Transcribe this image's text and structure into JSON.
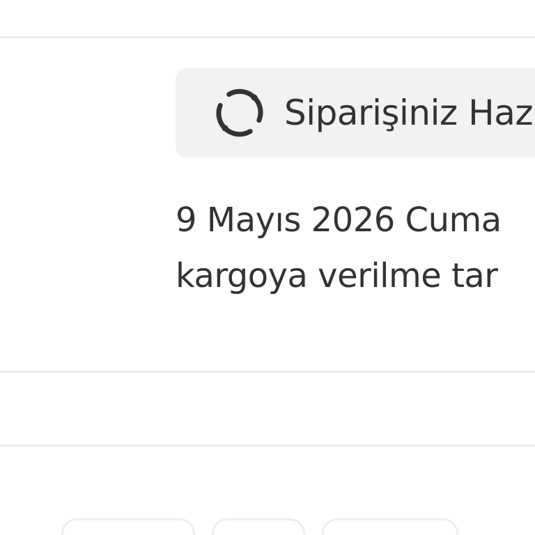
{
  "order_status": {
    "label": "Siparişiniz Haz",
    "icon": "refresh-icon"
  },
  "shipping_info": {
    "line1": "9 Mayıs 2026 Cuma",
    "line2": "kargoya verilme tar"
  },
  "colors": {
    "text": "#333333",
    "pill_background": "#f2f2f2",
    "divider": "#ebebeb",
    "chip_border": "#eeeeee"
  }
}
